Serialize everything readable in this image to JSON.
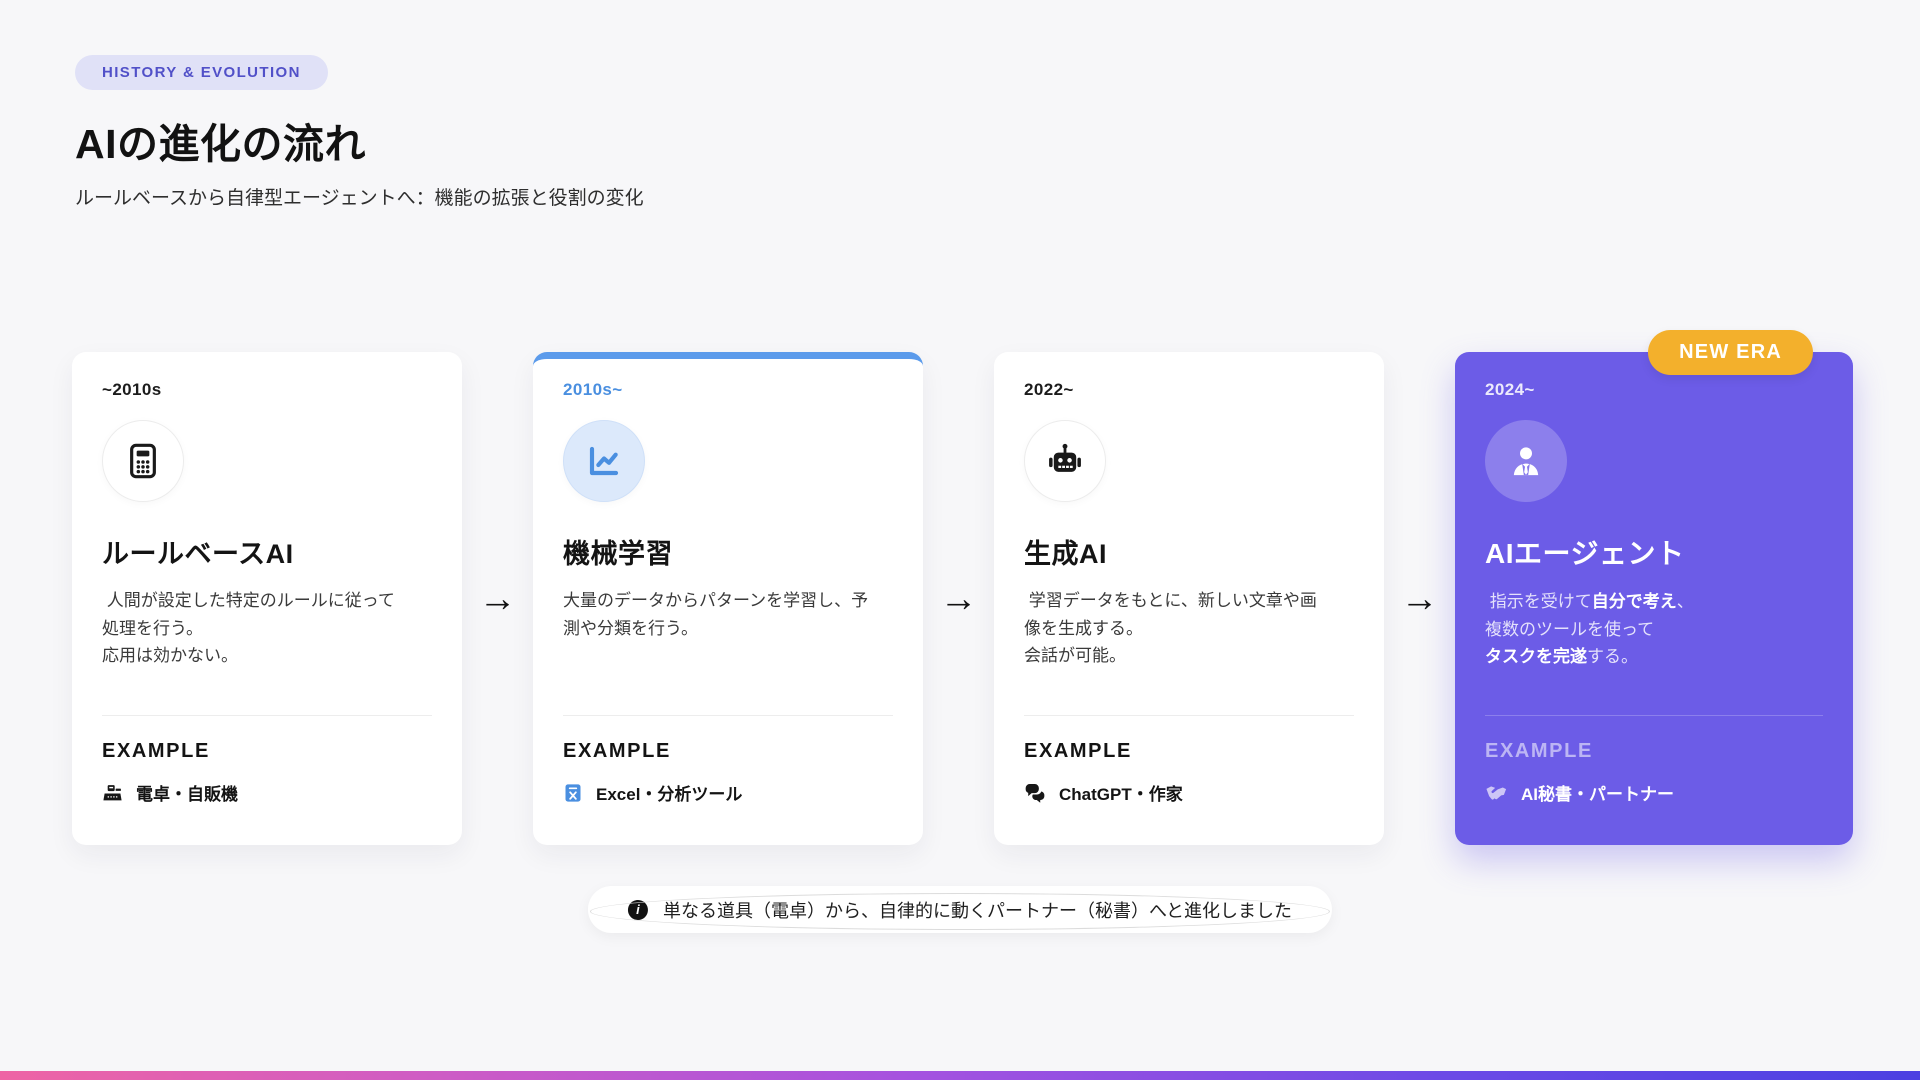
{
  "header": {
    "badge": "HISTORY & EVOLUTION",
    "title": "AIの進化の流れ",
    "subtitle": "ルールベースから自律型エージェントへ：機能の拡張と役割の変化"
  },
  "timeline": {
    "arrow": "→"
  },
  "cards": [
    {
      "era": "~2010s",
      "title": "ルールベースAI",
      "description": " 人間が設定した特定のルールに従って\n処理を行う。\n応用は効かない。",
      "example_label": "EXAMPLE",
      "example": "電卓・自販機",
      "icon": "calculator-icon",
      "example_icon": "cash-register-icon"
    },
    {
      "era": "2010s~",
      "title": "機械学習",
      "description": "大量のデータからパターンを学習し、予\n測や分類を行う。",
      "example_label": "EXAMPLE",
      "example": "Excel・分析ツール",
      "icon": "chart-line-icon",
      "example_icon": "excel-file-icon"
    },
    {
      "era": "2022~",
      "title": "生成AI",
      "description": " 学習データをもとに、新しい文章や画\n像を生成する。\n会話が可能。",
      "example_label": "EXAMPLE",
      "example": "ChatGPT・作家",
      "icon": "robot-icon",
      "example_icon": "chat-bubbles-icon"
    },
    {
      "era": "2024~",
      "badge": "NEW ERA",
      "title": "AIエージェント",
      "description_segments": [
        {
          "text": " 指示を受けて",
          "bold": false
        },
        {
          "text": "自分で考え",
          "bold": true
        },
        {
          "text": "、\n複数のツールを使って\n",
          "bold": false
        },
        {
          "text": "タスクを完遂",
          "bold": true
        },
        {
          "text": "する。",
          "bold": false
        }
      ],
      "example_label": "EXAMPLE",
      "example": "AI秘書・パートナー",
      "icon": "user-tie-icon",
      "example_icon": "handshake-icon"
    }
  ],
  "footnote": {
    "info_glyph": "i",
    "text": "単なる道具（電卓）から、自律的に動くパートナー（秘書）へと進化しました"
  },
  "colors": {
    "background": "#f7f7f9",
    "badge_lavender_bg": "#e0e1f7",
    "badge_lavender_text": "#5150c8",
    "accent_blue": "#5b9beb",
    "accent_blue_text": "#4a8fe0",
    "accent_purple": "#6c5ce7",
    "new_era_yellow": "#f3b02c",
    "gradient_bar": [
      "#ee64a4",
      "#a452e0",
      "#4b40e2"
    ]
  }
}
